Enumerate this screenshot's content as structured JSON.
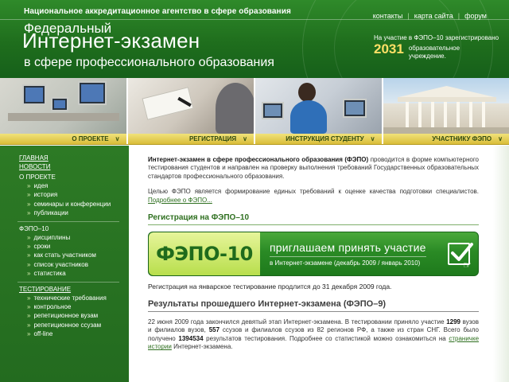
{
  "header": {
    "agency": "Национальное аккредитационное агентство в сфере образования",
    "title_line1": "Федеральный",
    "title_line2": "Интернет-экзамен",
    "title_line3": "в сфере профессионального образования",
    "links": [
      "контакты",
      "карта сайта",
      "форум"
    ],
    "reg_info_line": "На участие в ФЭПО–10 зарегистрировано",
    "reg_count": "2031",
    "reg_suffix": "образовательное учреждение."
  },
  "nav": {
    "items": [
      {
        "label": "О ПРОЕКТЕ"
      },
      {
        "label": "РЕГИСТРАЦИЯ"
      },
      {
        "label": "ИНСТРУКЦИЯ СТУДЕНТУ"
      },
      {
        "label": "УЧАСТНИКУ ФЭПО"
      }
    ]
  },
  "sidebar": {
    "main": "ГЛАВНАЯ",
    "news": "НОВОСТИ",
    "about": "О ПРОЕКТЕ",
    "about_items": [
      "идея",
      "история",
      "семинары и конференции",
      "публикации"
    ],
    "fepo": "ФЭПО–10",
    "fepo_items": [
      "дисциплины",
      "сроки",
      "как стать участником",
      "список участников",
      "статистика"
    ],
    "testing": "ТЕСТИРОВАНИЕ",
    "testing_items": [
      "технические требования",
      "контрольное",
      "репетиционное вузам",
      "репетиционное ссузам",
      "off-line"
    ]
  },
  "content": {
    "intro_bold": "Интернет-экзамен в сфере профессионального образования (ФЭПО)",
    "intro_rest": " проводится в форме компьютерного тестирования студентов и направлен на проверку выполнения требований Государственных образовательных стандартов профессионального образования.",
    "para2_text": "Целью ФЭПО является формирование единых требований к оценке качества подготовки специалистов. ",
    "para2_link": "Подробнее о ФЭПО...",
    "section1": "Регистрация на ФЭПО–10",
    "banner_logo": "ФЭПО-10",
    "banner_line1": "приглашаем принять участие",
    "banner_line2": "в Интернет-экзамене (декабрь 2009 / январь 2010)",
    "reg_note": "Регистрация на январское тестирование продлится до 31 декабря 2009 года.",
    "section2": "Результаты прошедшего Интернет-экзамена (ФЭПО–9)",
    "res_a": "22 июня 2009 года закончился девятый этап Интернет-экзамена. В тестировании приняло участие ",
    "res_n1": "1299",
    "res_b": " вузов и филиалов вузов, ",
    "res_n2": "557",
    "res_c": " ссузов и филиалов ссузов из 82 регионов РФ, а также из стран СНГ. Всего было получено ",
    "res_n3": "1394534",
    "res_d": " результатов тестирования. Подробнее со статистикой можно ознакомиться на ",
    "res_link": "страничке истории",
    "res_e": " Интернет-экзамена."
  },
  "colors": {
    "header_green": "#1f6e1d",
    "sidebar_green": "#2d7a25",
    "nav_gold": "#d9bd3a",
    "accent_yellow": "#ffe066",
    "link_green": "#2e6f1f"
  }
}
